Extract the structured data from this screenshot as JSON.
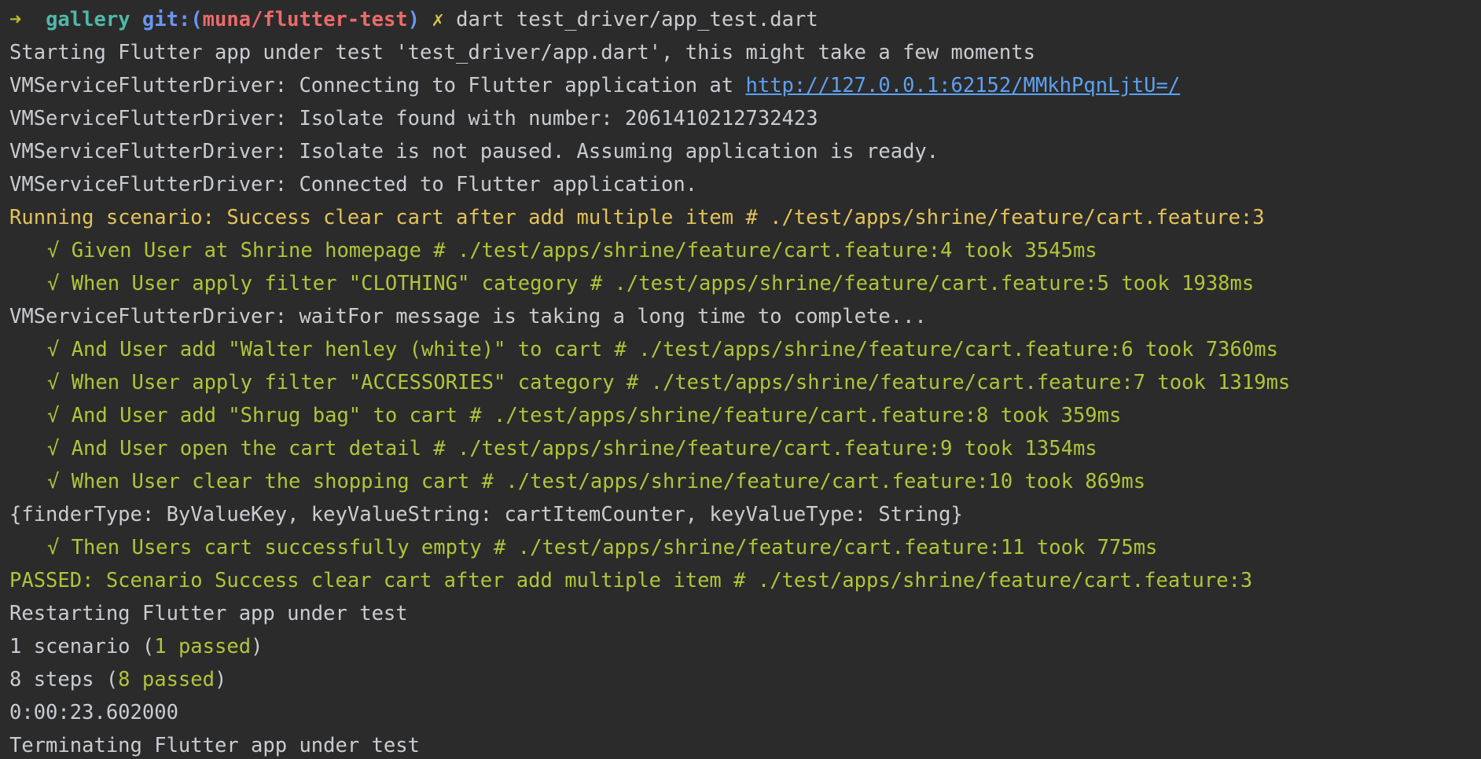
{
  "colors": {
    "background": "#2b2b2b",
    "default_text": "#c9ccd1",
    "scenario_yellow": "#e3c35a",
    "step_green": "#b2c439",
    "link_blue": "#5ea1f0",
    "prompt_arrow": "#b5bd2a",
    "prompt_dir": "#4fb8a8",
    "prompt_git": "#6896f2",
    "prompt_branch": "#ec6a6a"
  },
  "prompt": {
    "arrow": "➜",
    "directory": "gallery",
    "git_label": "git:(",
    "branch": "muna/flutter-test",
    "git_close": ")",
    "dirty_mark": "✗",
    "command": "dart test_driver/app_test.dart"
  },
  "lines": {
    "starting": "Starting Flutter app under test 'test_driver/app.dart', this might take a few moments",
    "connecting_prefix": "VMServiceFlutterDriver: Connecting to Flutter application at ",
    "connecting_url": "http://127.0.0.1:62152/MMkhPqnLjtU=/",
    "isolate_found": "VMServiceFlutterDriver: Isolate found with number: 2061410212732423",
    "isolate_not_paused": "VMServiceFlutterDriver: Isolate is not paused. Assuming application is ready.",
    "connected": "VMServiceFlutterDriver: Connected to Flutter application.",
    "running_scenario": "Running scenario: Success clear cart after add multiple item # ./test/apps/shrine/feature/cart.feature:3",
    "step_1": "√ Given User at Shrine homepage # ./test/apps/shrine/feature/cart.feature:4 took 3545ms",
    "step_2": "√ When User apply filter \"CLOTHING\" category # ./test/apps/shrine/feature/cart.feature:5 took 1938ms",
    "wait_for": "VMServiceFlutterDriver: waitFor message is taking a long time to complete...",
    "step_3": "√ And User add \"Walter henley (white)\" to cart # ./test/apps/shrine/feature/cart.feature:6 took 7360ms",
    "step_4": "√ When User apply filter \"ACCESSORIES\" category # ./test/apps/shrine/feature/cart.feature:7 took 1319ms",
    "step_5": "√ And User add \"Shrug bag\" to cart # ./test/apps/shrine/feature/cart.feature:8 took 359ms",
    "step_6": "√ And User open the cart detail # ./test/apps/shrine/feature/cart.feature:9 took 1354ms",
    "step_7": "√ When User clear the shopping cart # ./test/apps/shrine/feature/cart.feature:10 took 869ms",
    "finder": "{finderType: ByValueKey, keyValueString: cartItemCounter, keyValueType: String}",
    "step_8": "√ Then Users cart successfully empty # ./test/apps/shrine/feature/cart.feature:11 took 775ms",
    "passed": "PASSED: Scenario Success clear cart after add multiple item # ./test/apps/shrine/feature/cart.feature:3",
    "restarting": "Restarting Flutter app under test",
    "scenario_summary_prefix": "1 scenario (",
    "scenario_summary_passed": "1 passed",
    "scenario_summary_suffix": ")",
    "steps_summary_prefix": "8 steps (",
    "steps_summary_passed": "8 passed",
    "steps_summary_suffix": ")",
    "duration": "0:00:23.602000",
    "terminating": "Terminating Flutter app under test"
  }
}
